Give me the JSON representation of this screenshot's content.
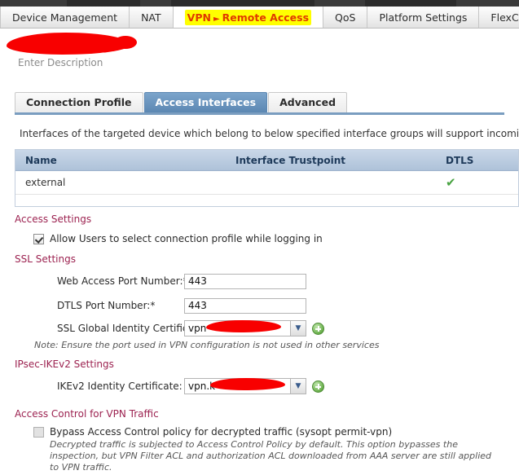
{
  "window": {
    "main_tabs": [
      {
        "label": "Device Management",
        "active": false
      },
      {
        "label": "NAT",
        "active": false
      },
      {
        "label": "VPN",
        "sub": "Remote Access",
        "active": true,
        "highlight": "#ffff00",
        "text_color": "#e03a00"
      },
      {
        "label": "QoS",
        "active": false
      },
      {
        "label": "Platform Settings",
        "active": false
      },
      {
        "label": "FlexCo",
        "active": false,
        "truncated": true
      }
    ]
  },
  "header": {
    "policy_title": "",
    "description_placeholder": "Enter Description"
  },
  "subtabs": [
    {
      "label": "Connection Profile",
      "active": false
    },
    {
      "label": "Access Interfaces",
      "active": true
    },
    {
      "label": "Advanced",
      "active": false
    }
  ],
  "interfaces": {
    "info_text": "Interfaces of the targeted device which belong to below specified interface groups will support incoming Re",
    "columns": [
      "Name",
      "Interface Trustpoint",
      "DTLS"
    ],
    "rows": [
      {
        "name": "external",
        "trustpoint": "",
        "dtls": "✔"
      }
    ]
  },
  "access_settings": {
    "heading": "Access Settings",
    "allow_users_label": "Allow Users to select connection profile while logging in",
    "allow_users_checked": true
  },
  "ssl_settings": {
    "heading": "SSL Settings",
    "web_port_label": "Web Access Port Number:*",
    "web_port_value": "443",
    "dtls_port_label": "DTLS Port Number:*",
    "dtls_port_value": "443",
    "ssl_cert_label": "SSL Global Identity Certificate:",
    "ssl_cert_value": "vpn",
    "add_button_icon": "plus-icon",
    "note": "Note: Ensure the port used in VPN configuration is not used in other services"
  },
  "ipsec_settings": {
    "heading": "IPsec-IKEv2 Settings",
    "ikev2_cert_label": "IKEv2 Identity Certificate:",
    "ikev2_cert_value": "vpn.k",
    "add_button_icon": "plus-icon"
  },
  "access_control": {
    "heading": "Access Control for VPN Traffic",
    "bypass_label": "Bypass Access Control policy for decrypted traffic (sysopt permit-vpn)",
    "bypass_checked": false,
    "bypass_note": "Decrypted traffic is subjected to Access Control Policy by default. This option bypasses the inspection, but VPN Filter ACL and authorization ACL downloaded from AAA server are still applied to VPN traffic."
  },
  "colors": {
    "section_heading": "#9c2250",
    "active_subtab": "#5c87b2",
    "table_header": "#aec2d9",
    "check_green": "#49a342",
    "redaction": "#f80000",
    "highlight_yellow": "#ffff00",
    "active_tab_text": "#e03a00"
  }
}
